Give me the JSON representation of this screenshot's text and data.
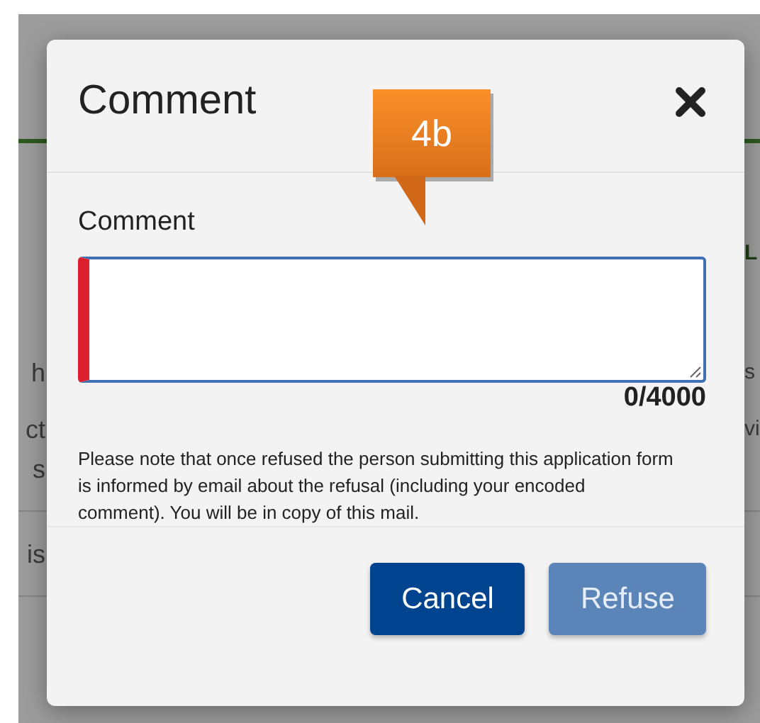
{
  "background": {
    "left_fragments": [
      {
        "text": "h"
      },
      {
        "text": "ct"
      },
      {
        "text": "s"
      },
      {
        "text": "is"
      }
    ],
    "right_fragments": [
      {
        "text": "L"
      },
      {
        "text": "s"
      },
      {
        "text": "vi"
      }
    ]
  },
  "dialog": {
    "title": "Comment",
    "annotation": "4b",
    "field": {
      "label": "Comment",
      "invalid": true,
      "counter": "0/4000"
    },
    "note": "Please note that once refused the person submitting this application form is informed by email about the refusal (including your encoded comment). You will be in copy of this mail.",
    "buttons": [
      {
        "label": "Cancel",
        "kind": "primary",
        "disabled": false
      },
      {
        "label": "Refuse",
        "kind": "primary",
        "disabled": true
      }
    ]
  }
}
